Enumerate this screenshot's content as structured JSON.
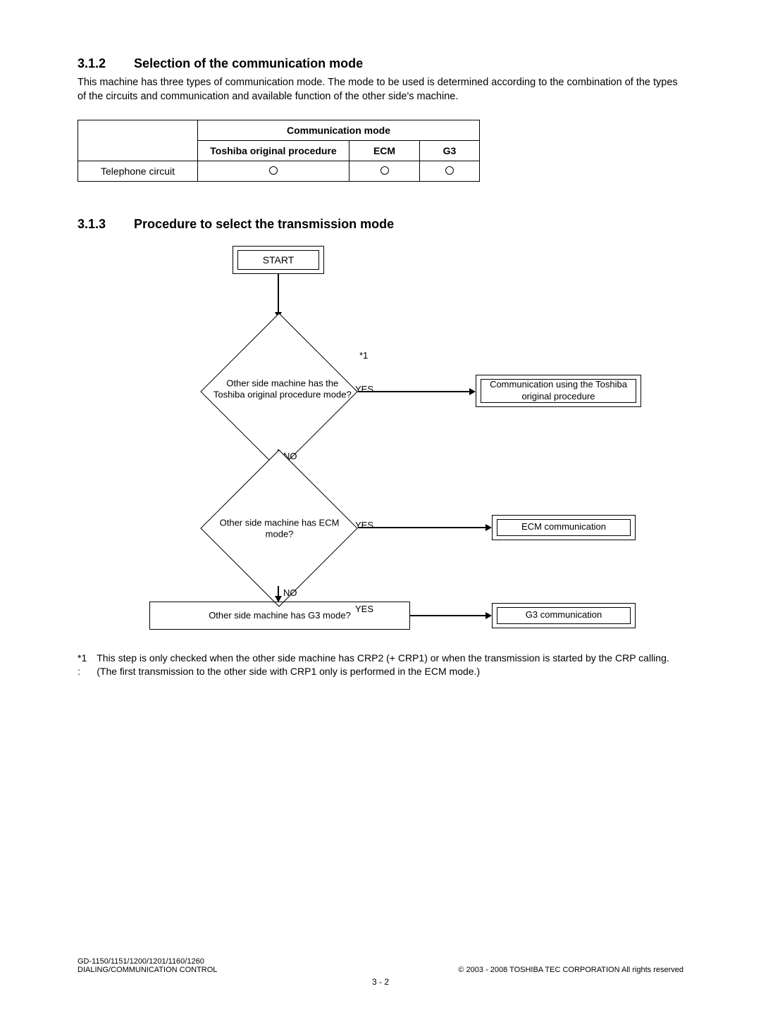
{
  "sec312": {
    "num": "3.1.2",
    "title": "Selection of the communication mode",
    "para": "This machine has three types of communication mode. The mode to be used is determined according to the combination of the types of the circuits and communication and available function of the other side's machine."
  },
  "table": {
    "header_span": "Communication mode",
    "cols": {
      "c1": "Toshiba original procedure",
      "c2": "ECM",
      "c3": "G3"
    },
    "row_label": "Telephone circuit"
  },
  "sec313": {
    "num": "3.1.3",
    "title": "Procedure to select the transmission mode"
  },
  "flow": {
    "start": "START",
    "d1": "Other side machine has the Toshiba original procedure mode?",
    "d2": "Other side machine has ECM mode?",
    "d3": "Other side machine has G3 mode?",
    "res1": "Communication using the Toshiba original procedure",
    "res2": "ECM communication",
    "res3": "G3 communication",
    "yes": "YES",
    "no": "NO",
    "star1": "*1"
  },
  "foot": {
    "label": "*1\n:",
    "text": "This step is only checked when the other side machine has CRP2 (+ CRP1) or when the transmission is started by the CRP calling. (The first transmission to the other side with CRP1 only is performed in the ECM mode.)"
  },
  "footer": {
    "left1": "GD-1150/1151/1200/1201/1160/1260",
    "left2": "DIALING/COMMUNICATION CONTROL",
    "right": "© 2003 - 2008 TOSHIBA TEC CORPORATION All rights reserved",
    "page": "3 - 2"
  }
}
